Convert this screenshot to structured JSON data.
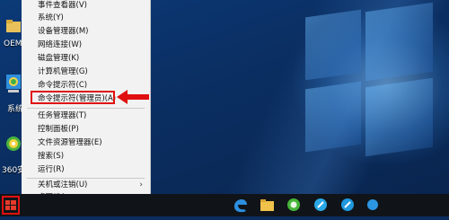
{
  "desktop": {
    "icons": [
      {
        "label": "OEM",
        "icon": "folder-icon"
      },
      {
        "label": "系统",
        "icon": "computer-icon"
      },
      {
        "label": "360安",
        "icon": "360-icon"
      }
    ]
  },
  "winx_menu": {
    "items": [
      {
        "label": "事件查看器(V)"
      },
      {
        "label": "系统(Y)"
      },
      {
        "label": "设备管理器(M)"
      },
      {
        "label": "网络连接(W)"
      },
      {
        "label": "磁盘管理(K)"
      },
      {
        "label": "计算机管理(G)"
      },
      {
        "label": "命令提示符(C)"
      },
      {
        "label": "命令提示符(管理员)(A)"
      },
      {
        "label": "任务管理器(T)"
      },
      {
        "label": "控制面板(P)"
      },
      {
        "label": "文件资源管理器(E)"
      },
      {
        "label": "搜索(S)"
      },
      {
        "label": "运行(R)"
      },
      {
        "label": "关机或注销(U)"
      },
      {
        "label": "桌面(D)"
      }
    ],
    "submenu_arrow": "›"
  },
  "taskbar": {
    "pinned": [
      "edge-icon",
      "file-explorer-icon",
      "360-browser-icon",
      "store-icon",
      "app-icon",
      "app2-icon"
    ]
  },
  "colors": {
    "highlight": "#e01010",
    "menu_bg": "#f2f2f2",
    "taskbar_bg": "#101418"
  }
}
